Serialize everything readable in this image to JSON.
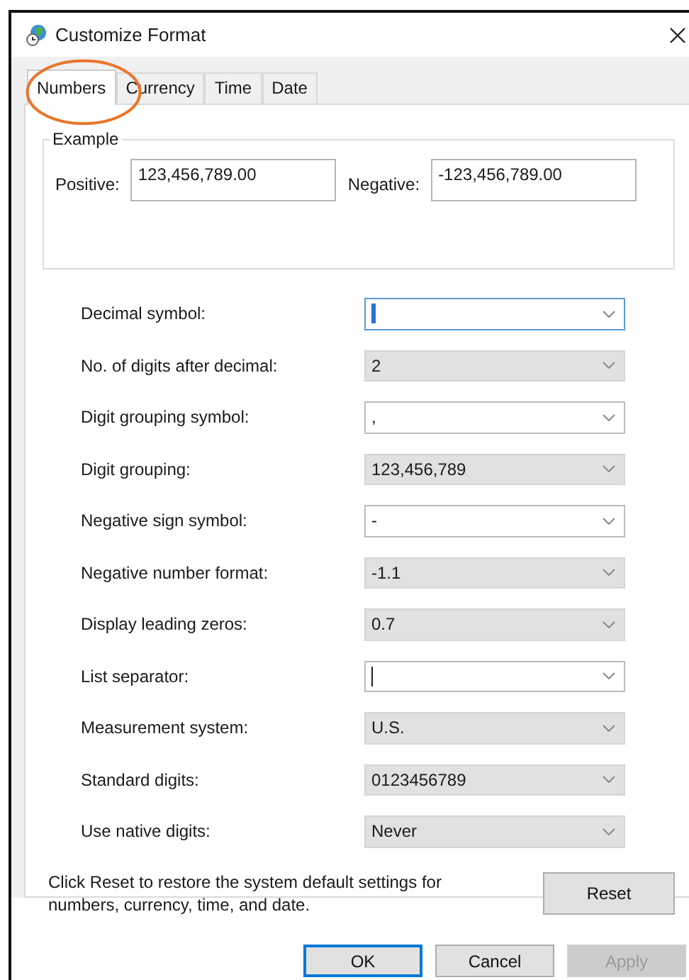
{
  "window": {
    "title": "Customize Format"
  },
  "tabs": [
    {
      "label": "Numbers",
      "selected": true,
      "circled": true
    },
    {
      "label": "Currency",
      "selected": false,
      "circled": false
    },
    {
      "label": "Time",
      "selected": false,
      "circled": false
    },
    {
      "label": "Date",
      "selected": false,
      "circled": false
    }
  ],
  "example": {
    "title": "Example",
    "positive_label": "Positive:",
    "positive_value": "123,456,789.00",
    "negative_label": "Negative:",
    "negative_value": "-123,456,789.00"
  },
  "settings": [
    {
      "label": "Decimal symbol:",
      "kind": "editable",
      "focused": true,
      "caret": true
    },
    {
      "label": "No. of digits after decimal:",
      "kind": "fixed",
      "value": "2"
    },
    {
      "label": "Digit grouping symbol:",
      "kind": "editable",
      "value": ",",
      "focused": false
    },
    {
      "label": "Digit grouping:",
      "kind": "fixed",
      "value": "123,456,789"
    },
    {
      "label": "Negative sign symbol:",
      "kind": "editable",
      "value": "-",
      "focused": false
    },
    {
      "label": "Negative number format:",
      "kind": "fixed",
      "value": "-1.1"
    },
    {
      "label": "Display leading zeros:",
      "kind": "fixed",
      "value": "0.7"
    },
    {
      "label": "List separator:",
      "kind": "editable",
      "focused": false,
      "caret": true
    },
    {
      "label": "Measurement system:",
      "kind": "fixed",
      "value": "U.S."
    },
    {
      "label": "Standard digits:",
      "kind": "fixed",
      "value": "0123456789"
    },
    {
      "label": "Use native digits:",
      "kind": "fixed",
      "value": "Never"
    }
  ],
  "reset": {
    "note": "Click Reset to restore the system default settings for numbers, currency, time, and date.",
    "button": "Reset"
  },
  "buttons": [
    {
      "label": "OK",
      "default": true,
      "disabled": false
    },
    {
      "label": "Cancel",
      "default": false,
      "disabled": false
    },
    {
      "label": "Apply",
      "default": false,
      "disabled": true
    }
  ]
}
